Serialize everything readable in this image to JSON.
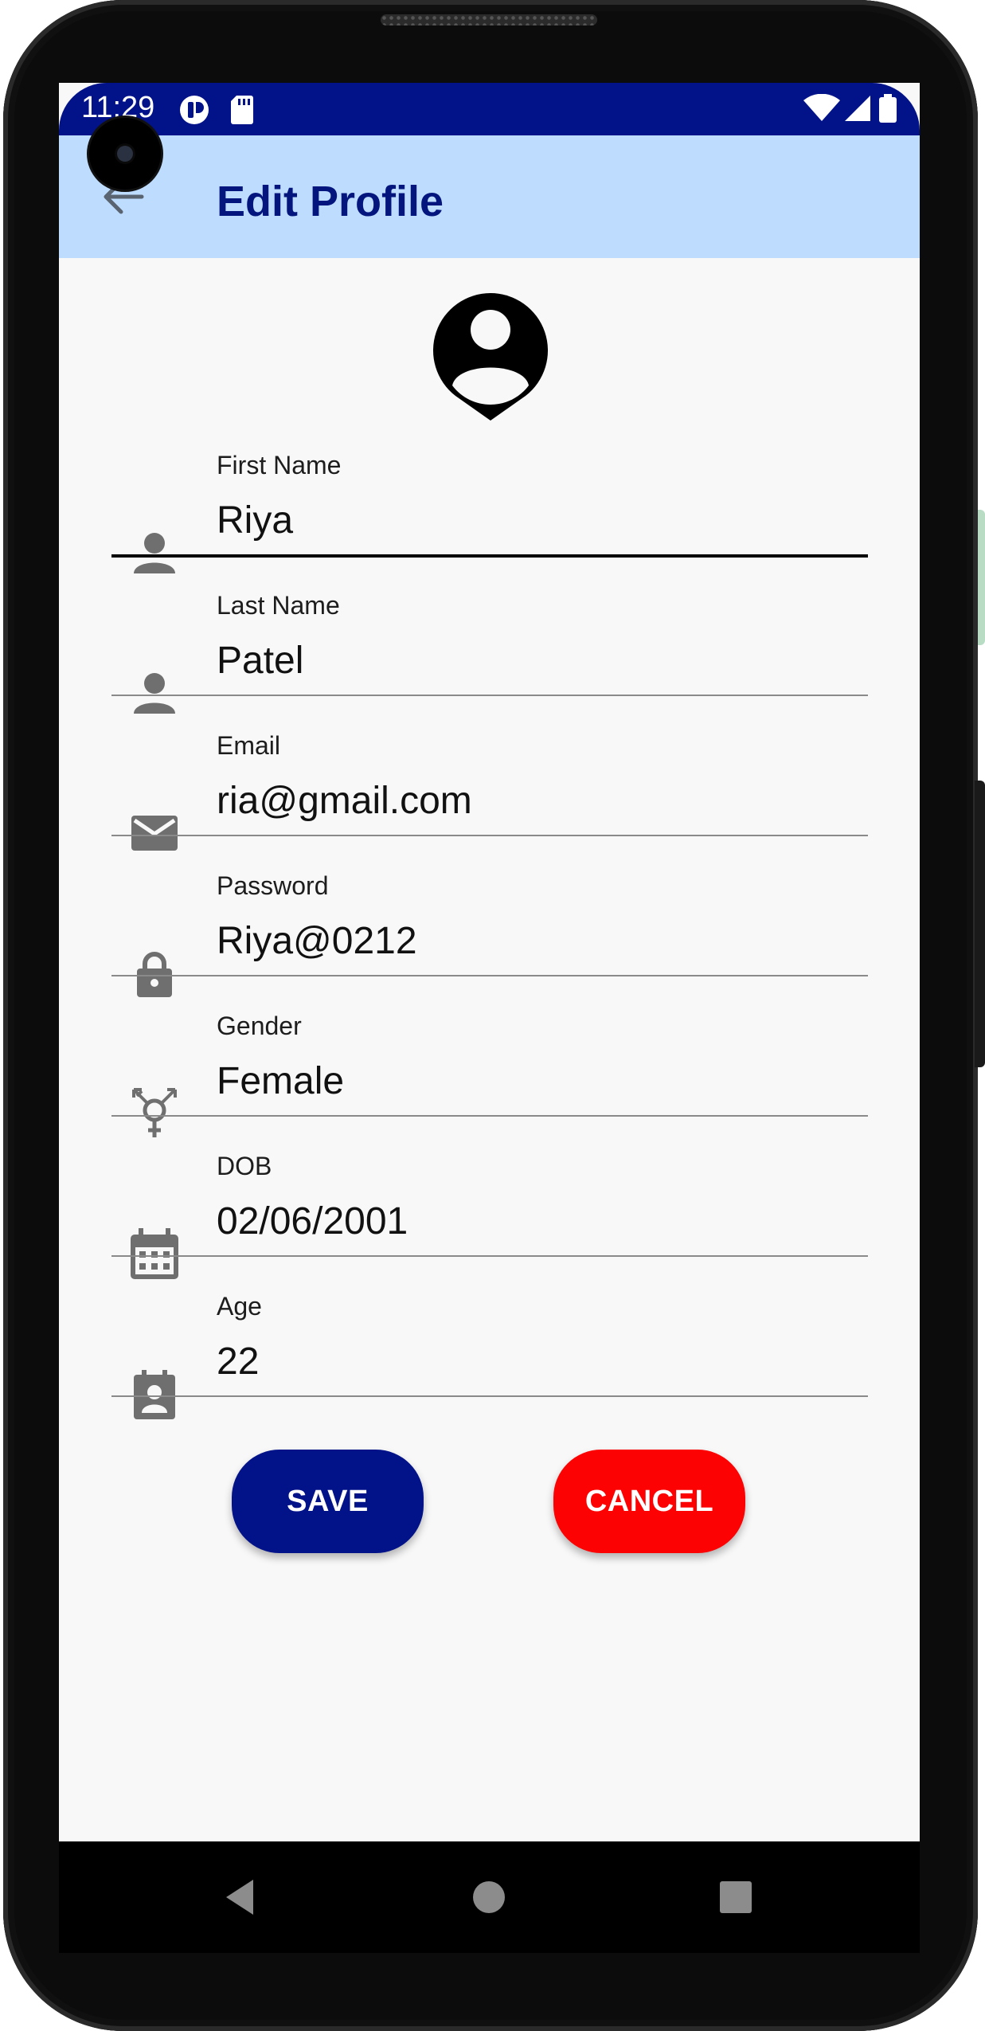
{
  "status_bar": {
    "time": "11:29",
    "icons": [
      "app-notification-icon",
      "sd-card-icon",
      "wifi-icon",
      "cell-signal-icon",
      "battery-icon"
    ]
  },
  "app_bar": {
    "title": "Edit Profile",
    "back_icon": "arrow-back-icon"
  },
  "profile": {
    "avatar_icon": "account-pin-icon"
  },
  "fields": [
    {
      "label": "First Name",
      "value": "Riya",
      "icon": "person-icon",
      "focused": true
    },
    {
      "label": "Last Name",
      "value": "Patel",
      "icon": "person-icon"
    },
    {
      "label": "Email",
      "value": "ria@gmail.com",
      "icon": "mail-icon"
    },
    {
      "label": "Password",
      "value": "Riya@0212",
      "icon": "lock-icon"
    },
    {
      "label": "Gender",
      "value": "Female",
      "icon": "gender-icon"
    },
    {
      "label": "DOB",
      "value": "02/06/2001",
      "icon": "calendar-icon"
    },
    {
      "label": "Age",
      "value": "22",
      "icon": "contact-badge-icon"
    }
  ],
  "buttons": {
    "save_label": "SAVE",
    "cancel_label": "CANCEL"
  },
  "colors": {
    "status_bar": "#021389",
    "app_bar": "#bedcfe",
    "title": "#04167e",
    "save": "#021389",
    "cancel": "#fc0202",
    "icon": "#6f6f6f"
  },
  "nav_bar": {
    "icons": [
      "back-triangle-icon",
      "home-circle-icon",
      "recents-square-icon"
    ]
  }
}
